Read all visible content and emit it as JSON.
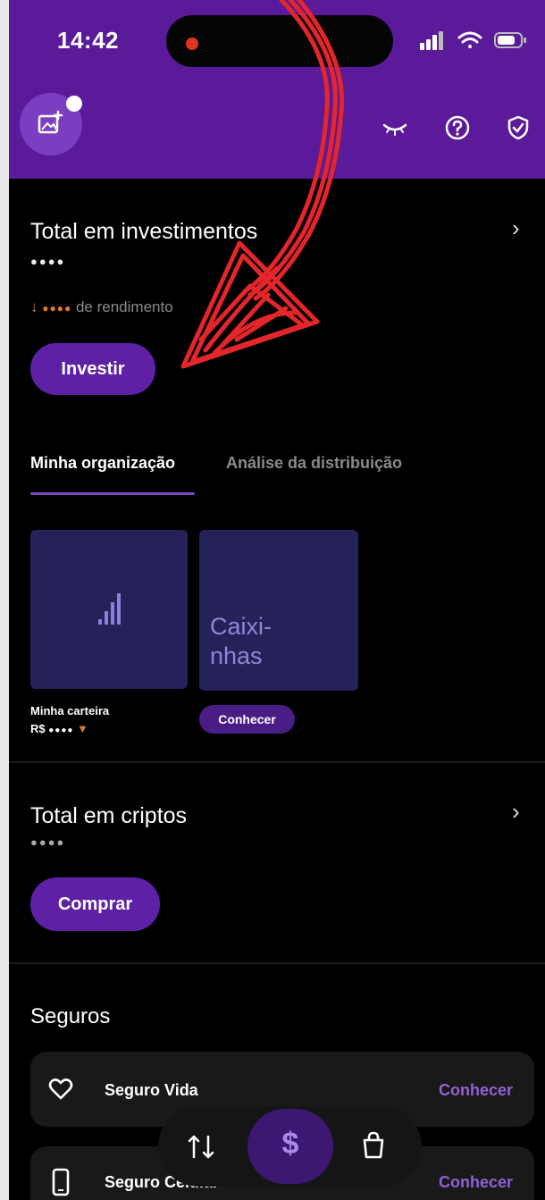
{
  "status_bar": {
    "time": "14:42"
  },
  "header": {
    "profile_icon": "image-sparkle-icon",
    "actions": [
      "eye-closed-icon",
      "help-circle-icon",
      "shield-check-icon"
    ]
  },
  "investments": {
    "title": "Total em investimentos",
    "value_masked": "●●●●",
    "yield_arrow": "↓",
    "yield_masked": "●●●●",
    "yield_label": "de rendimento",
    "invest_button": "Investir"
  },
  "tabs": [
    {
      "label": "Minha organização",
      "active": true
    },
    {
      "label": "Análise da distribuição",
      "active": false
    }
  ],
  "cards": [
    {
      "name": "Minha carteira",
      "value_prefix": "R$",
      "value_masked": "●●●●"
    },
    {
      "name": "Caixi-\nnhas",
      "cta": "Conhecer"
    }
  ],
  "crypto": {
    "title": "Total em criptos",
    "value_masked": "●●●●",
    "buy_button": "Comprar"
  },
  "insurance": {
    "title": "Seguros",
    "items": [
      {
        "label": "Seguro Vida",
        "cta": "Conhecer",
        "icon": "heart-icon"
      },
      {
        "label": "Seguro Celular",
        "cta": "Conhecer",
        "icon": "phone-icon"
      }
    ]
  },
  "bottom_nav": {
    "items": [
      "transfer-arrows-icon",
      "dollar-icon",
      "shopping-bag-icon"
    ],
    "center_symbol": "$",
    "active": "dollar-icon"
  },
  "colors": {
    "brand_purple": "#5b1a9a",
    "button_purple": "#5e21a6",
    "annotation_red": "#e3262a"
  }
}
